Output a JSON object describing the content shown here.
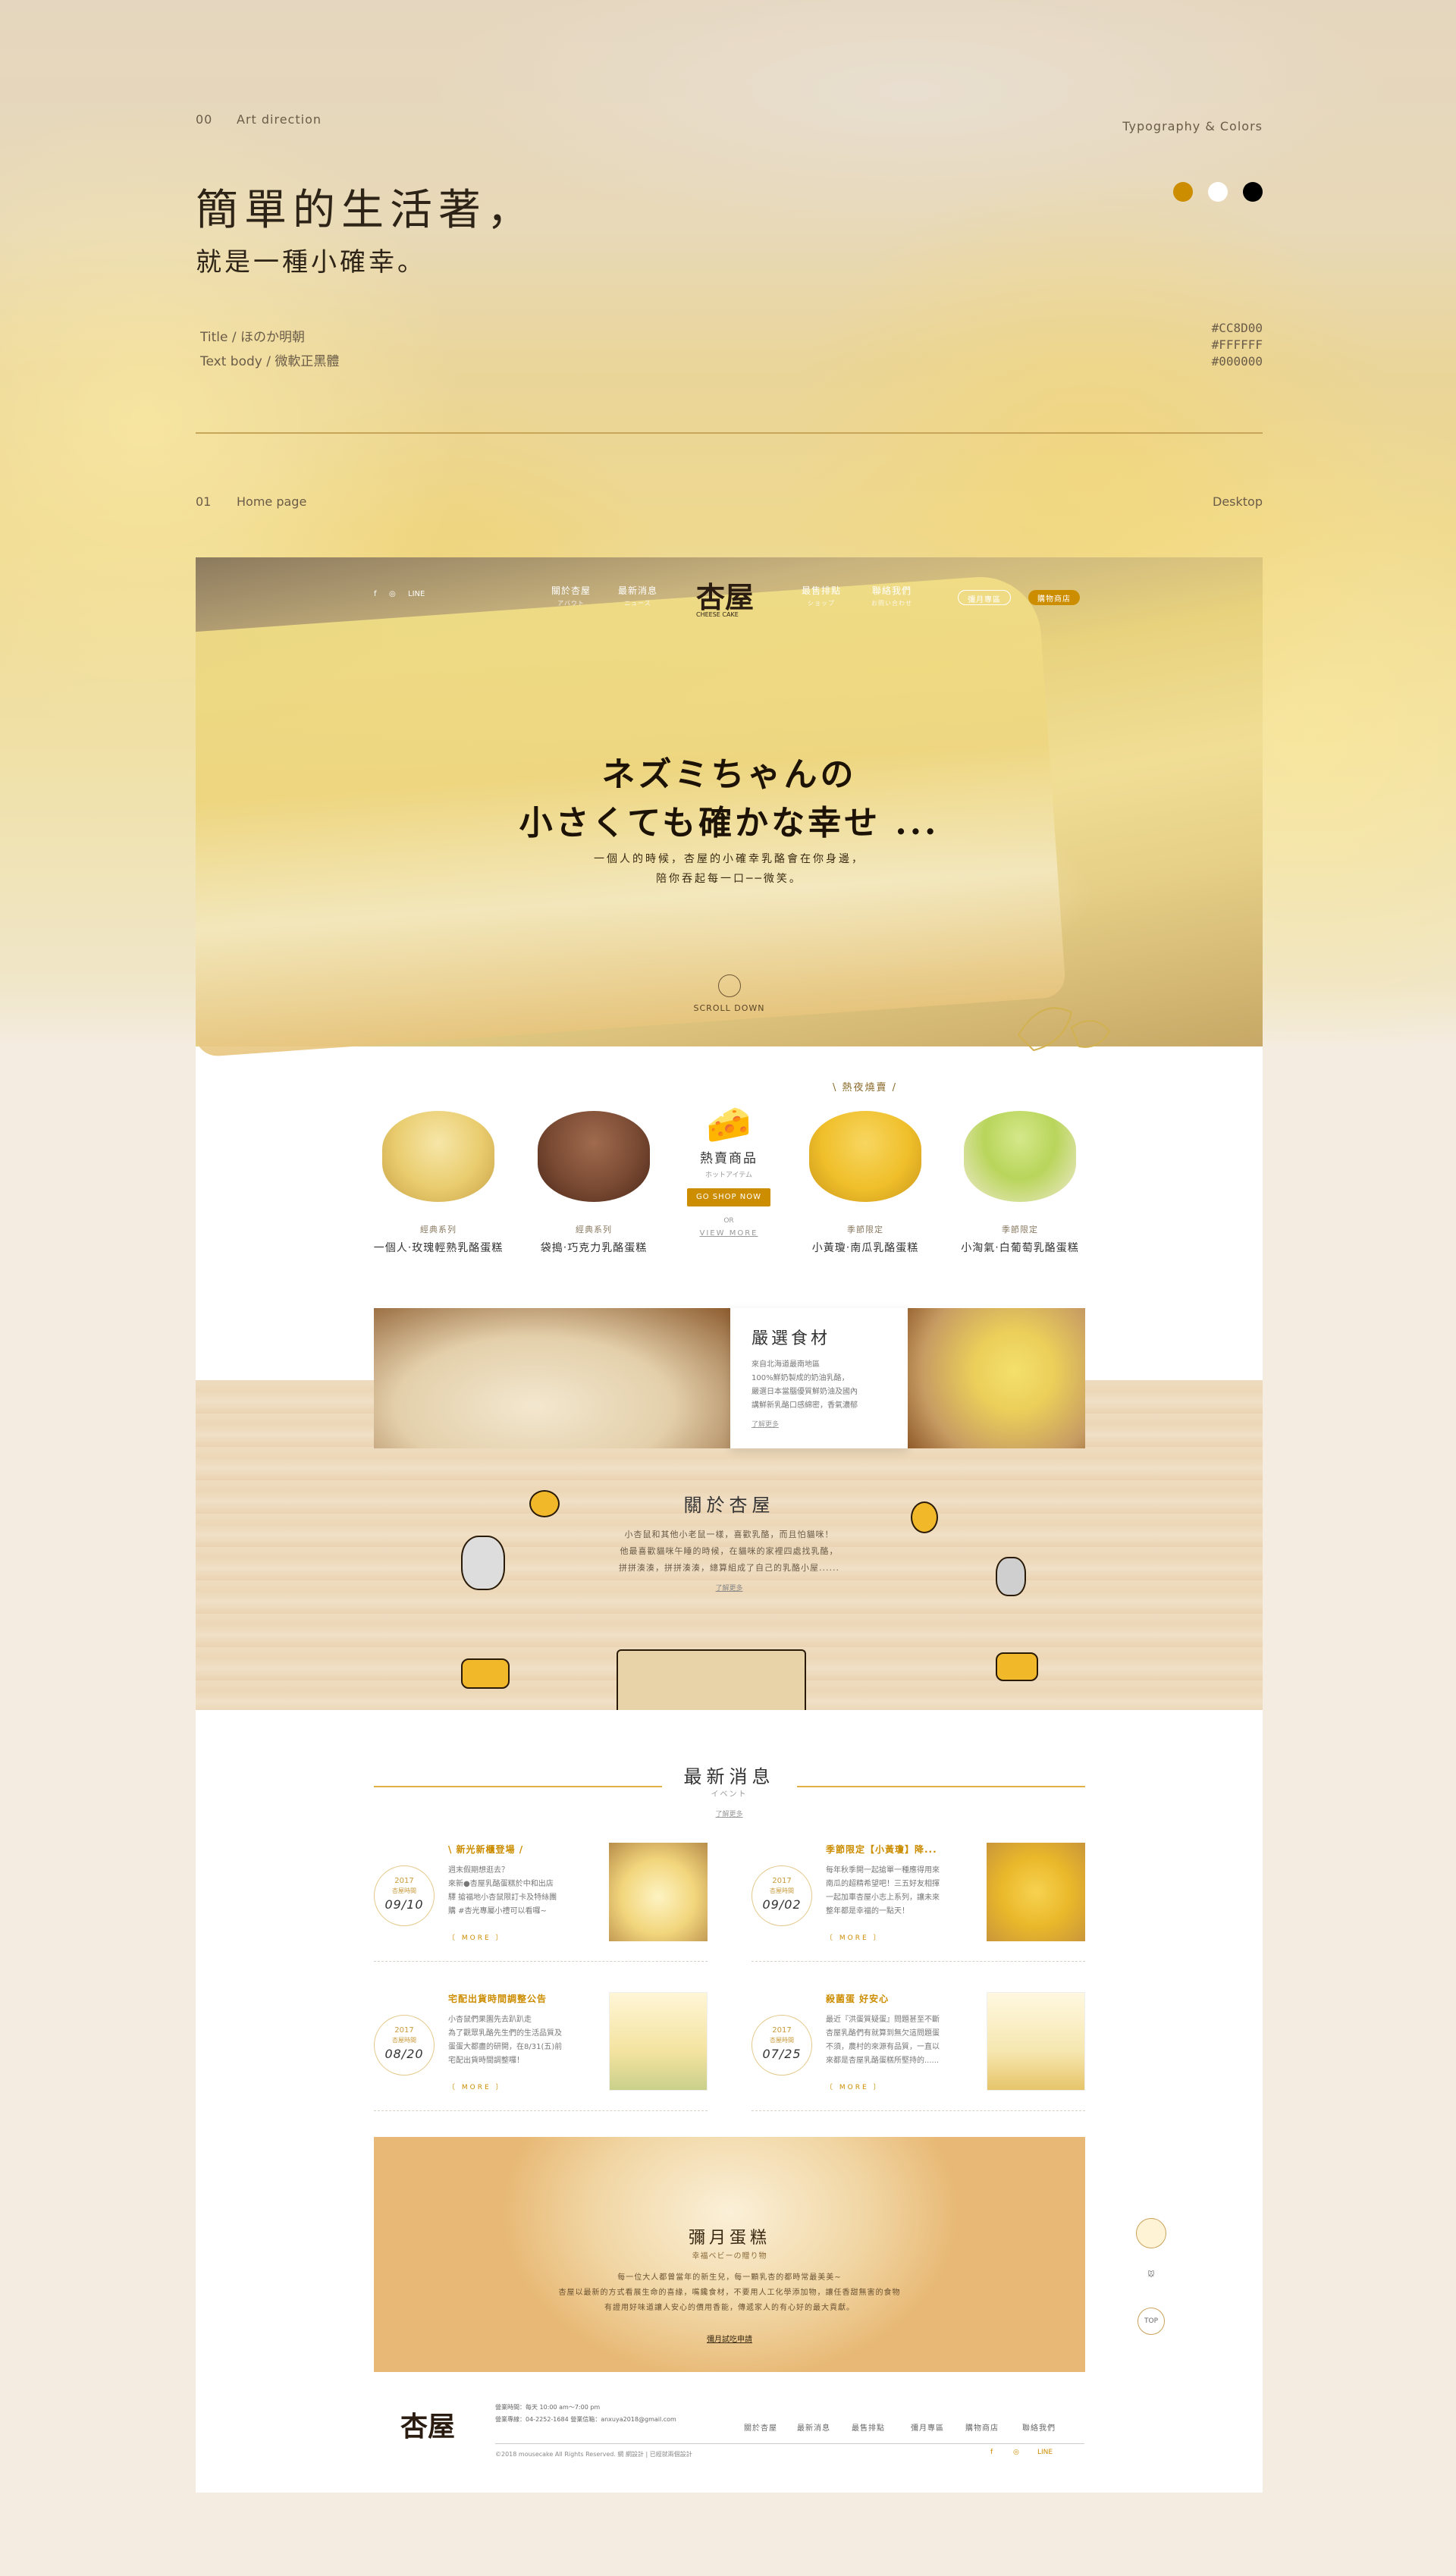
{
  "art_direction": {
    "number": "00",
    "label": "Art direction",
    "right_label": "Typography & Colors",
    "headline_line1": "簡單的生活著，",
    "headline_line2": "就是一種小確幸。",
    "font_title": "Title / ほのか明朝",
    "font_body": "Text body / 微軟正黑體",
    "colors": [
      "#CC8D00",
      "#FFFFFF",
      "#000000"
    ]
  },
  "home_page": {
    "number": "01",
    "label": "Home page",
    "right_label": "Desktop"
  },
  "nav": {
    "social": [
      "f",
      "◎",
      "LINE"
    ],
    "items": [
      {
        "label": "關於杏屋",
        "sub": "アバウト"
      },
      {
        "label": "最新消息",
        "sub": "ニュース"
      },
      {
        "label": "最售排點",
        "sub": "ショップ"
      },
      {
        "label": "聯絡我們",
        "sub": "お問い合わせ"
      }
    ],
    "logo_text": "杏屋",
    "logo_sub": "CHEESE CAKE",
    "pill_outline": "彌月專區",
    "pill_filled": "購物商店"
  },
  "hero": {
    "title_line1": "ネズミちゃんの",
    "title_line2": "小さくても確かな幸せ ...",
    "sub_line1": "一個人的時候，杏屋的小確幸乳酪會在你身邊，",
    "sub_line2": "陪你吞起每一口──微笑。",
    "scroll": "SCROLL DOWN"
  },
  "products": {
    "tag": "\\ 熱夜燒賣 /",
    "items": [
      {
        "category": "經典系列",
        "name": "一個人‧玫瑰輕熟乳酪蛋糕",
        "color": "#e9cc6e"
      },
      {
        "category": "經典系列",
        "name": "袋搗‧巧克力乳酪蛋糕",
        "color": "#7a4a33"
      },
      {
        "category": "季節限定",
        "name": "小黃瓊‧南瓜乳酪蛋糕",
        "color": "#f0bf2a"
      },
      {
        "category": "季節限定",
        "name": "小淘氣‧白葡萄乳酪蛋糕",
        "color": "#b9d55b"
      }
    ],
    "hot_title": "熱賣商品",
    "hot_sub": "ホットアイテム",
    "hot_button": "GO SHOP NOW",
    "hot_or": "OR",
    "hot_more": "VIEW MORE"
  },
  "ingredients": {
    "title": "嚴選食材",
    "body": "來自北海道最南地區\n100%鮮奶製成的奶油乳酪，\n嚴選日本當腦優質鮮奶油及國內\n講鮮新乳酪口感綿密，香氣濃郁",
    "link": "了解更多"
  },
  "about": {
    "title": "關於杏屋",
    "body_line1": "小杏鼠和其他小老鼠一樣，喜歡乳酪，而且怕貓咪！",
    "body_line2": "他最喜歡貓咪午睡的時候，在貓咪的家裡四處找乳酪，",
    "body_line3": "拼拼湊湊，拼拼湊湊，總算組成了自己的乳酪小屋......",
    "link": "了解更多"
  },
  "news": {
    "title": "最新消息",
    "sub": "イベント",
    "link": "了解更多",
    "items": [
      {
        "year": "2017",
        "season": "杏屋時間",
        "date": "09/10",
        "title": "\\ 新光新櫃登場 /",
        "text": "週末假期想逛去？\n來新●杏屋乳酪蛋糕於中和出店\n驛 搶福地小杏鼠限訂卡及特絲團\n購 #杏光專屬小禮可以看囉~",
        "more": "〔 MORE 〕"
      },
      {
        "year": "2017",
        "season": "杏屋時間",
        "date": "09/02",
        "title": "季節限定【小黃瓊】降...",
        "text": "每年秋季開一起搶單一種應得用來\n南瓜的超精希望吧！三五好友相揮\n一起加車杏屋小志上系列，讓未來\n整年都是幸福的一點天！",
        "more": "〔 MORE 〕"
      },
      {
        "year": "2017",
        "season": "杏屋時間",
        "date": "08/20",
        "title": "宅配出貨時間調整公告",
        "text": "小杏鼠們果園先去趴趴走\n為了觀眾乳酪先生們的生活品質及\n蛋蛋大都盡的研開，在8/31(五)前\n宅配出貨時間調整囉！",
        "more": "〔 MORE 〕"
      },
      {
        "year": "2017",
        "season": "杏屋時間",
        "date": "07/25",
        "title": "殺菌蛋 好安心",
        "text": "最近『洪蛋質疑蛋』問題甚至不斷\n杏屋乳酪們有就算到無欠這問題蛋\n不須，農村的來源有品質，一直以\n來都是杏屋乳酪蛋糕所堅持的......",
        "more": "〔 MORE 〕"
      }
    ]
  },
  "banner": {
    "title": "彌月蛋糕",
    "sub": "幸福ベビーの贈り物",
    "body_line1": "每一位大人都曾當年的新生兒，每一顆乳杏的都時常最美美~",
    "body_line2": "杏屋以最新的方式看展生命的喜緣，嘴饞食材，不要用人工化學添加物，讓任香甜無害的食物",
    "body_line3": "有證用好味道讓人安心的價用香能，傳遞家人的有心好的最大貢獻。",
    "button": "彌月試吃申請"
  },
  "footer": {
    "logo": "杏屋",
    "info_line1": "營業時間：每天 10:00 am～7:00 pm",
    "info_line2": "營業專線：04-2252-1684  營業信箱：anxuya2018@gmail.com",
    "copyright": "©2018 mousecake All Rights Reserved. 網 網設計 | 已經就兩個設計",
    "nav": [
      "關於杏屋",
      "最新消息",
      "最售排點",
      "彌月專區",
      "購物商店",
      "聯絡我們"
    ],
    "social": [
      "f",
      "◎",
      "LINE"
    ]
  },
  "floating": {
    "top_label": "TOP"
  }
}
